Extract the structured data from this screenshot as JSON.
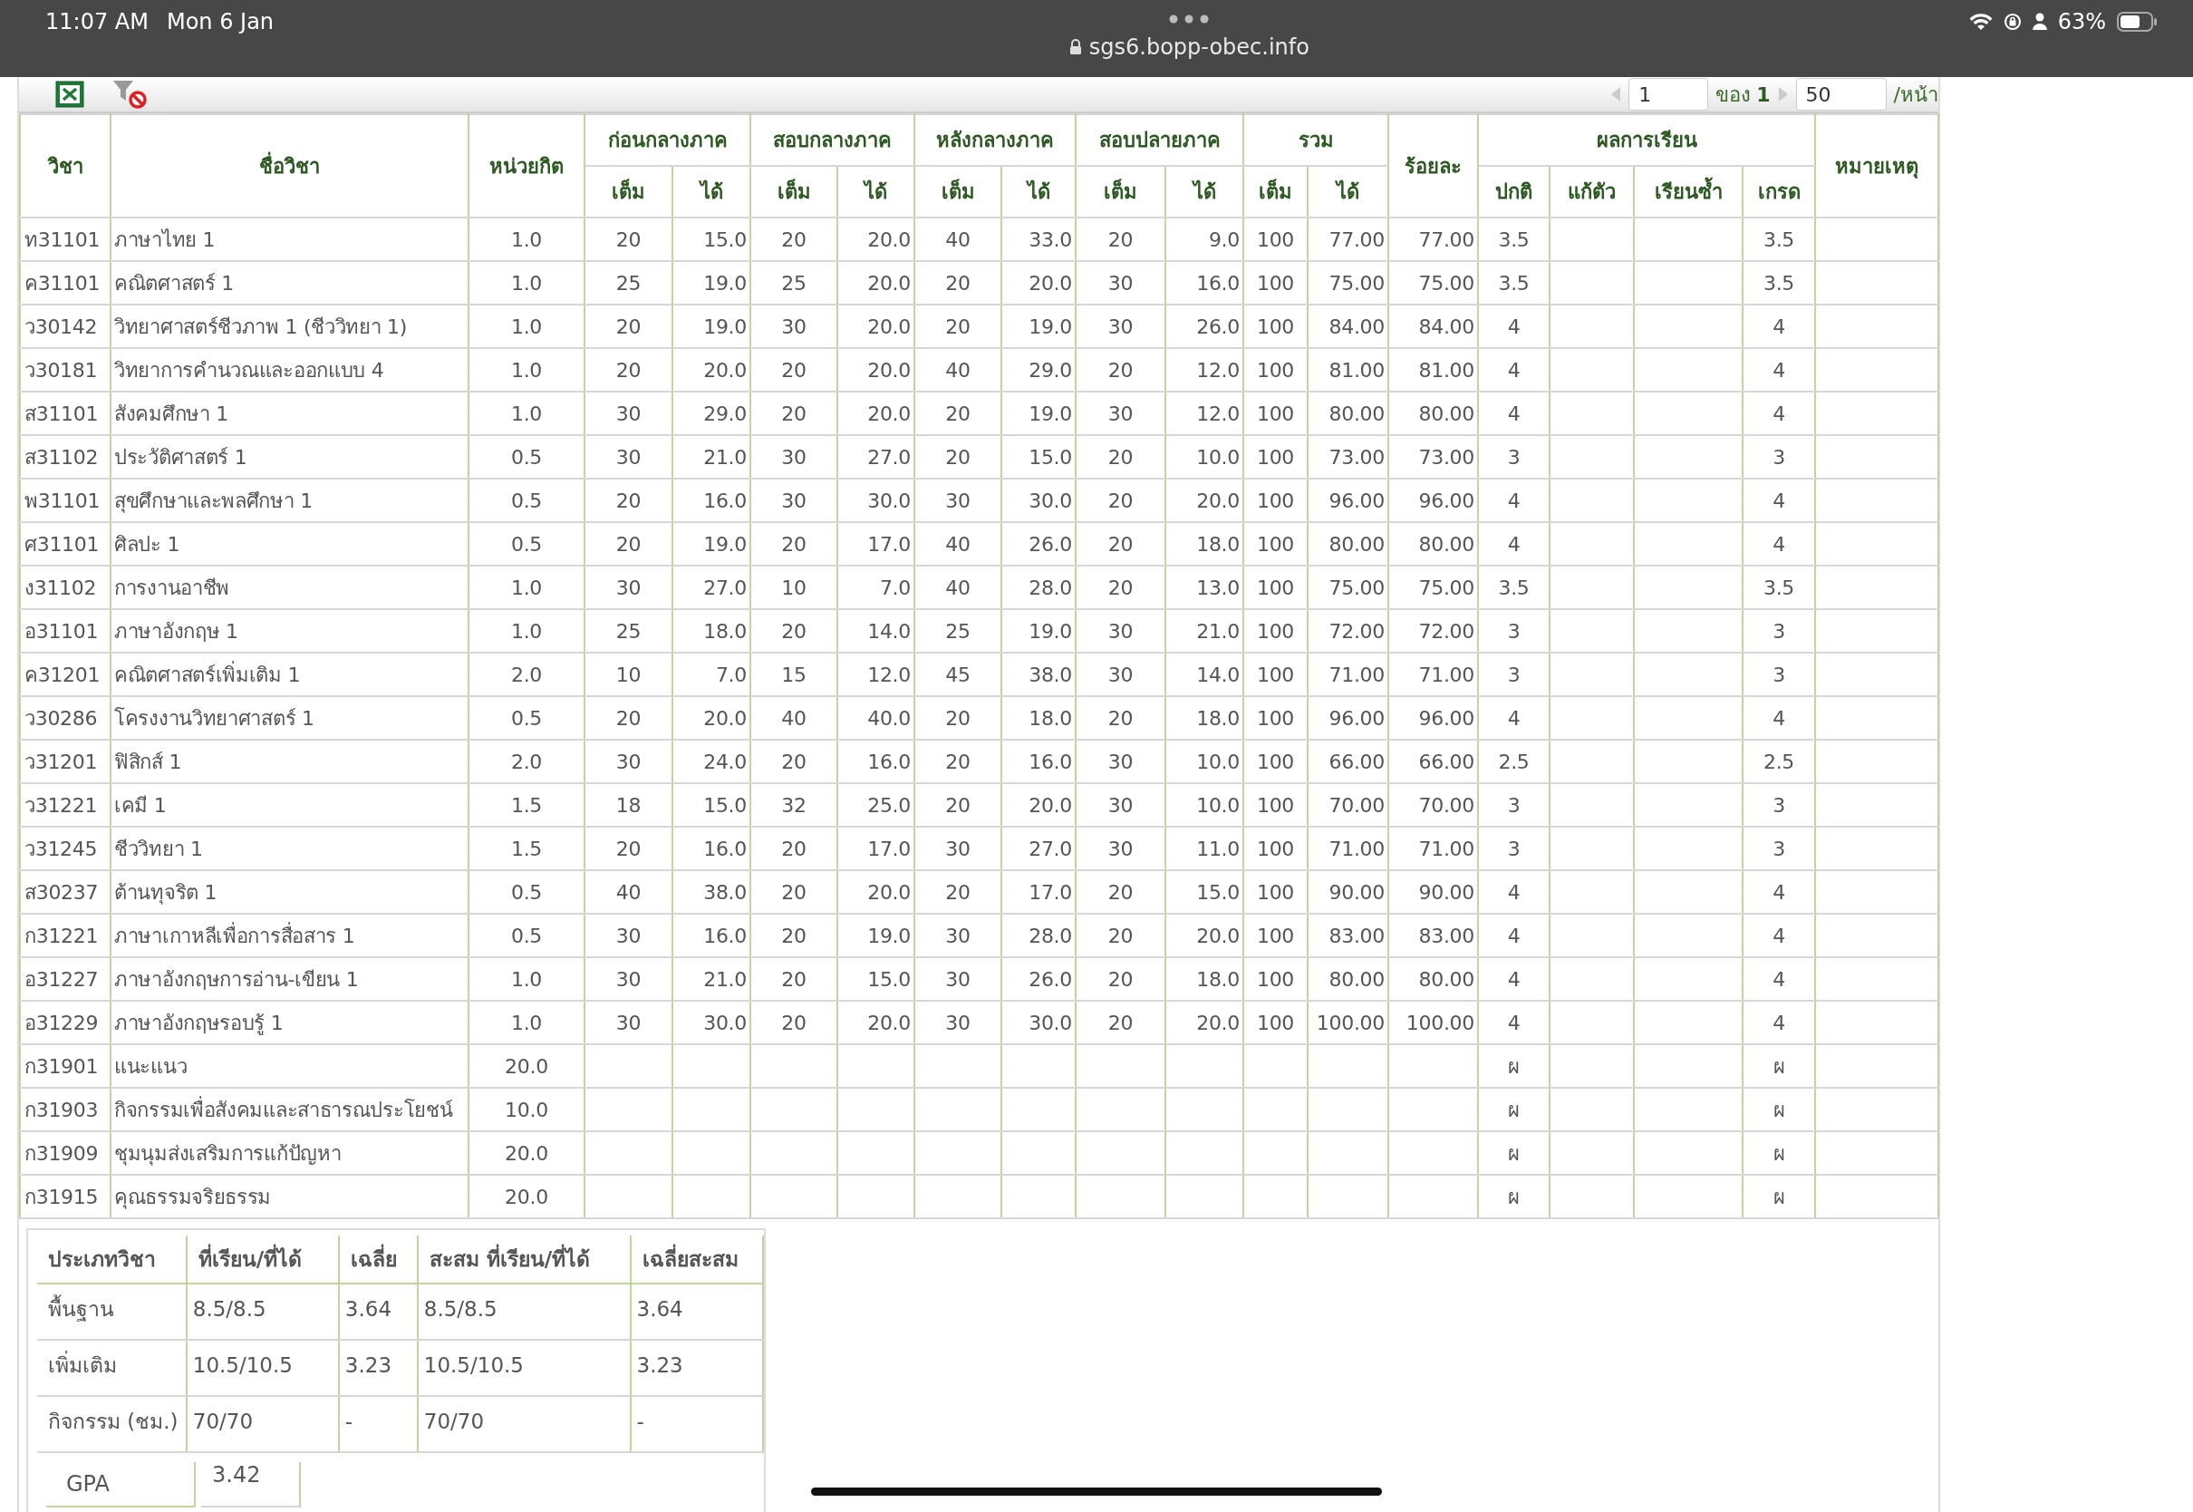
{
  "status_bar": {
    "time": "11:07 AM",
    "date": "Mon 6 Jan",
    "url": "sgs6.bopp-obec.info",
    "battery": "63%"
  },
  "toolbar": {
    "page": "1",
    "of_label": "ของ",
    "page_count": "1",
    "per_page": "50",
    "per_page_label": "/หน้า"
  },
  "grades_table": {
    "header": {
      "code": "วิชา",
      "name": "ชื่อวิชา",
      "credit": "หน่วยกิต",
      "score_groups": [
        {
          "label": "ก่อนกลางภาค",
          "sub": [
            "เต็ม",
            "ได้"
          ]
        },
        {
          "label": "สอบกลางภาค",
          "sub": [
            "เต็ม",
            "ได้"
          ]
        },
        {
          "label": "หลังกลางภาค",
          "sub": [
            "เต็ม",
            "ได้"
          ]
        },
        {
          "label": "สอบปลายภาค",
          "sub": [
            "เต็ม",
            "ได้"
          ]
        },
        {
          "label": "รวม",
          "sub": [
            "เต็ม",
            "ได้"
          ]
        }
      ],
      "percent": "ร้อยละ",
      "result": {
        "label": "ผลการเรียน",
        "sub": [
          "ปกติ",
          "แก้ตัว",
          "เรียนซ้ำ",
          "เกรด"
        ]
      },
      "note": "หมายเหตุ"
    },
    "rows": [
      {
        "code": "ท31101",
        "name": "ภาษาไทย 1",
        "credit": "1.0",
        "scores": [
          "20",
          "15.0",
          "20",
          "20.0",
          "40",
          "33.0",
          "20",
          "9.0",
          "100",
          "77.00"
        ],
        "percent": "77.00",
        "normal": "3.5",
        "grade": "3.5"
      },
      {
        "code": "ค31101",
        "name": "คณิตศาสตร์ 1",
        "credit": "1.0",
        "scores": [
          "25",
          "19.0",
          "25",
          "20.0",
          "20",
          "20.0",
          "30",
          "16.0",
          "100",
          "75.00"
        ],
        "percent": "75.00",
        "normal": "3.5",
        "grade": "3.5"
      },
      {
        "code": "ว30142",
        "name": "วิทยาศาสตร์ชีวภาพ 1 (ชีววิทยา 1)",
        "credit": "1.0",
        "scores": [
          "20",
          "19.0",
          "30",
          "20.0",
          "20",
          "19.0",
          "30",
          "26.0",
          "100",
          "84.00"
        ],
        "percent": "84.00",
        "normal": "4",
        "grade": "4"
      },
      {
        "code": "ว30181",
        "name": "วิทยาการคำนวณและออกแบบ 4",
        "credit": "1.0",
        "scores": [
          "20",
          "20.0",
          "20",
          "20.0",
          "40",
          "29.0",
          "20",
          "12.0",
          "100",
          "81.00"
        ],
        "percent": "81.00",
        "normal": "4",
        "grade": "4"
      },
      {
        "code": "ส31101",
        "name": "สังคมศึกษา 1",
        "credit": "1.0",
        "scores": [
          "30",
          "29.0",
          "20",
          "20.0",
          "20",
          "19.0",
          "30",
          "12.0",
          "100",
          "80.00"
        ],
        "percent": "80.00",
        "normal": "4",
        "grade": "4"
      },
      {
        "code": "ส31102",
        "name": "ประวัติศาสตร์ 1",
        "credit": "0.5",
        "scores": [
          "30",
          "21.0",
          "30",
          "27.0",
          "20",
          "15.0",
          "20",
          "10.0",
          "100",
          "73.00"
        ],
        "percent": "73.00",
        "normal": "3",
        "grade": "3"
      },
      {
        "code": "พ31101",
        "name": "สุขศึกษาและพลศึกษา 1",
        "credit": "0.5",
        "scores": [
          "20",
          "16.0",
          "30",
          "30.0",
          "30",
          "30.0",
          "20",
          "20.0",
          "100",
          "96.00"
        ],
        "percent": "96.00",
        "normal": "4",
        "grade": "4"
      },
      {
        "code": "ศ31101",
        "name": "ศิลปะ 1",
        "credit": "0.5",
        "scores": [
          "20",
          "19.0",
          "20",
          "17.0",
          "40",
          "26.0",
          "20",
          "18.0",
          "100",
          "80.00"
        ],
        "percent": "80.00",
        "normal": "4",
        "grade": "4"
      },
      {
        "code": "ง31102",
        "name": "การงานอาชีพ",
        "credit": "1.0",
        "scores": [
          "30",
          "27.0",
          "10",
          "7.0",
          "40",
          "28.0",
          "20",
          "13.0",
          "100",
          "75.00"
        ],
        "percent": "75.00",
        "normal": "3.5",
        "grade": "3.5"
      },
      {
        "code": "อ31101",
        "name": "ภาษาอังกฤษ 1",
        "credit": "1.0",
        "scores": [
          "25",
          "18.0",
          "20",
          "14.0",
          "25",
          "19.0",
          "30",
          "21.0",
          "100",
          "72.00"
        ],
        "percent": "72.00",
        "normal": "3",
        "grade": "3"
      },
      {
        "code": "ค31201",
        "name": "คณิตศาสตร์เพิ่มเติม 1",
        "credit": "2.0",
        "scores": [
          "10",
          "7.0",
          "15",
          "12.0",
          "45",
          "38.0",
          "30",
          "14.0",
          "100",
          "71.00"
        ],
        "percent": "71.00",
        "normal": "3",
        "grade": "3"
      },
      {
        "code": "ว30286",
        "name": "โครงงานวิทยาศาสตร์ 1",
        "credit": "0.5",
        "scores": [
          "20",
          "20.0",
          "40",
          "40.0",
          "20",
          "18.0",
          "20",
          "18.0",
          "100",
          "96.00"
        ],
        "percent": "96.00",
        "normal": "4",
        "grade": "4"
      },
      {
        "code": "ว31201",
        "name": "ฟิสิกส์ 1",
        "credit": "2.0",
        "scores": [
          "30",
          "24.0",
          "20",
          "16.0",
          "20",
          "16.0",
          "30",
          "10.0",
          "100",
          "66.00"
        ],
        "percent": "66.00",
        "normal": "2.5",
        "grade": "2.5"
      },
      {
        "code": "ว31221",
        "name": "เคมี 1",
        "credit": "1.5",
        "scores": [
          "18",
          "15.0",
          "32",
          "25.0",
          "20",
          "20.0",
          "30",
          "10.0",
          "100",
          "70.00"
        ],
        "percent": "70.00",
        "normal": "3",
        "grade": "3"
      },
      {
        "code": "ว31245",
        "name": "ชีววิทยา 1",
        "credit": "1.5",
        "scores": [
          "20",
          "16.0",
          "20",
          "17.0",
          "30",
          "27.0",
          "30",
          "11.0",
          "100",
          "71.00"
        ],
        "percent": "71.00",
        "normal": "3",
        "grade": "3"
      },
      {
        "code": "ส30237",
        "name": "ต้านทุจริต 1",
        "credit": "0.5",
        "scores": [
          "40",
          "38.0",
          "20",
          "20.0",
          "20",
          "17.0",
          "20",
          "15.0",
          "100",
          "90.00"
        ],
        "percent": "90.00",
        "normal": "4",
        "grade": "4"
      },
      {
        "code": "ก31221",
        "name": "ภาษาเกาหลีเพื่อการสื่อสาร 1",
        "credit": "0.5",
        "scores": [
          "30",
          "16.0",
          "20",
          "19.0",
          "30",
          "28.0",
          "20",
          "20.0",
          "100",
          "83.00"
        ],
        "percent": "83.00",
        "normal": "4",
        "grade": "4"
      },
      {
        "code": "อ31227",
        "name": "ภาษาอังกฤษการอ่าน-เขียน 1",
        "credit": "1.0",
        "scores": [
          "30",
          "21.0",
          "20",
          "15.0",
          "30",
          "26.0",
          "20",
          "18.0",
          "100",
          "80.00"
        ],
        "percent": "80.00",
        "normal": "4",
        "grade": "4"
      },
      {
        "code": "อ31229",
        "name": "ภาษาอังกฤษรอบรู้ 1",
        "credit": "1.0",
        "scores": [
          "30",
          "30.0",
          "20",
          "20.0",
          "30",
          "30.0",
          "20",
          "20.0",
          "100",
          "100.00"
        ],
        "percent": "100.00",
        "normal": "4",
        "grade": "4"
      },
      {
        "code": "ก31901",
        "name": "แนะแนว",
        "credit": "20.0",
        "normal": "ผ",
        "grade": "ผ"
      },
      {
        "code": "ก31903",
        "name": "กิจกรรมเพื่อสังคมและสาธารณประโยชน์",
        "credit": "10.0",
        "normal": "ผ",
        "grade": "ผ"
      },
      {
        "code": "ก31909",
        "name": "ชุมนุมส่งเสริมการแก้ปัญหา",
        "credit": "20.0",
        "normal": "ผ",
        "grade": "ผ"
      },
      {
        "code": "ก31915",
        "name": "คุณธรรมจริยธรรม",
        "credit": "20.0",
        "normal": "ผ",
        "grade": "ผ"
      }
    ]
  },
  "summary": {
    "columns": [
      "ประเภทวิชา",
      "ที่เรียน/ที่ได้",
      "เฉลี่ย",
      "สะสม ที่เรียน/ที่ได้",
      "เฉลี่ยสะสม"
    ],
    "rows": [
      [
        "พื้นฐาน",
        "8.5/8.5",
        "3.64",
        "8.5/8.5",
        "3.64"
      ],
      [
        "เพิ่มเติม",
        "10.5/10.5",
        "3.23",
        "10.5/10.5",
        "3.23"
      ],
      [
        "กิจกรรม (ชม.)",
        "70/70",
        "-",
        "70/70",
        "-"
      ]
    ],
    "gpa": {
      "label": "GPA",
      "value": "3.42"
    }
  }
}
